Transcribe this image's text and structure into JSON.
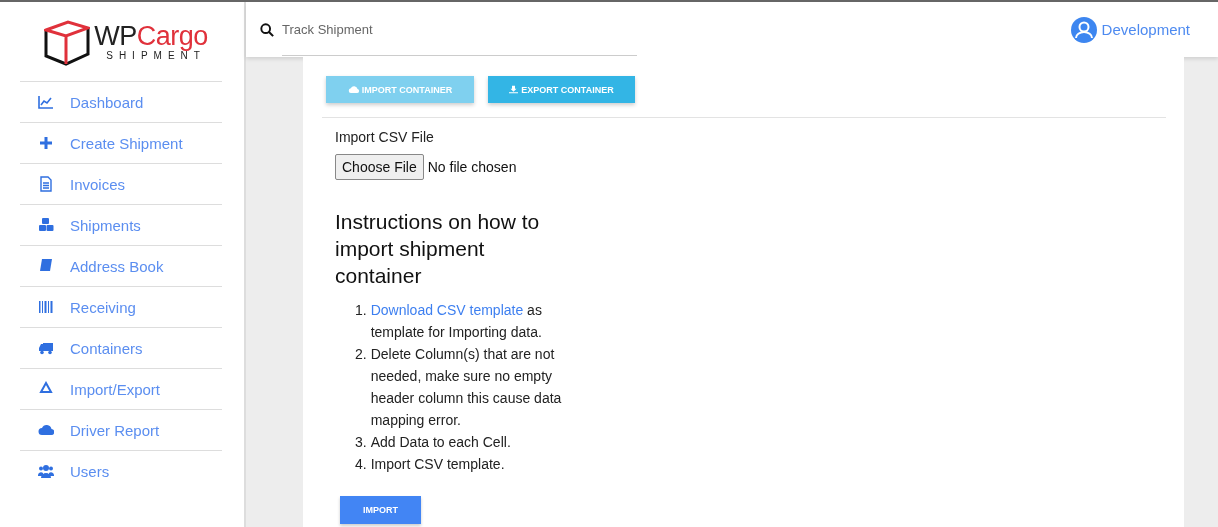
{
  "logo": {
    "wordmark": [
      "WP",
      "Cargo"
    ],
    "tagline": "SHIPMENT"
  },
  "sidebar": {
    "items": [
      {
        "label": "Dashboard",
        "selected": false
      },
      {
        "label": "Create Shipment",
        "selected": false
      },
      {
        "label": "Invoices",
        "selected": false
      },
      {
        "label": "Shipments",
        "selected": false
      },
      {
        "label": "Address Book",
        "selected": false
      },
      {
        "label": "Receiving",
        "selected": false
      },
      {
        "label": "Containers",
        "selected": false
      },
      {
        "label": "Import/Export",
        "selected": false
      },
      {
        "label": "Driver Report",
        "selected": false
      },
      {
        "label": "Users",
        "selected": false
      }
    ]
  },
  "header": {
    "search": {
      "placeholder": "Track Shipment"
    },
    "user": "Development"
  },
  "tabs": [
    {
      "label": "IMPORT CONTAINER",
      "selected": true
    },
    {
      "label": "EXPORT CONTAINER",
      "selected": false
    }
  ],
  "import_form": {
    "label": "Import CSV File",
    "file_button": "Choose File",
    "file_status": "No file chosen"
  },
  "instructions": {
    "title": "Instructions on how to import shipment container",
    "steps": [
      {
        "number": "1.",
        "link": "Download CSV template",
        "text": "as template for Importing data."
      },
      {
        "number": "2.",
        "text": "Delete Column(s) that are not needed, make sure no empty header column this cause data mapping error."
      },
      {
        "number": "3.",
        "text": "Add Data to each Cell."
      },
      {
        "number": "4.",
        "text": "Import CSV template."
      }
    ]
  },
  "submit": "IMPORT"
}
